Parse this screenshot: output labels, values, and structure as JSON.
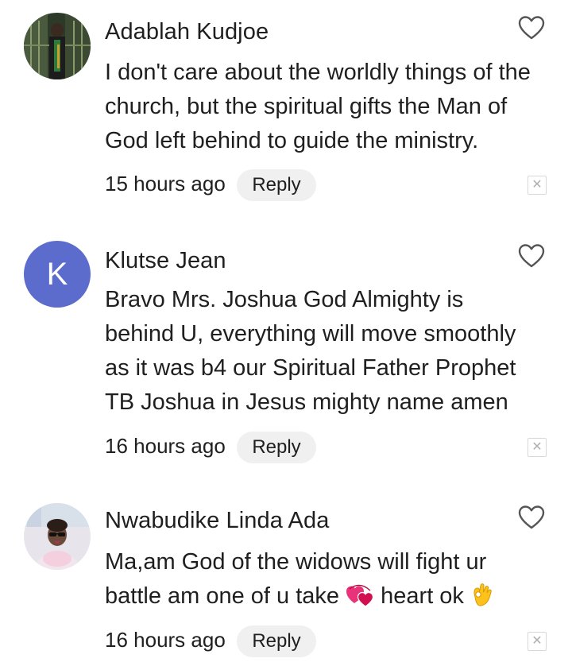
{
  "comments": [
    {
      "author": "Adablah Kudjoe",
      "text": "I don't care about the worldly things of the\nchurch, but the spiritual gifts the Man of\nGod left behind to guide the ministry.",
      "time": "15 hours ago",
      "reply_label": "Reply",
      "avatar_type": "photo"
    },
    {
      "author": "Klutse Jean",
      "avatar_letter": "K",
      "avatar_color": "#5b6ccc",
      "text": "Bravo Mrs. Joshua God Almighty is\nbehind U, everything will move smoothly\nas it was b4 our Spiritual Father Prophet\nTB Joshua in Jesus mighty name amen",
      "time": "16 hours ago",
      "reply_label": "Reply"
    },
    {
      "author": "Nwabudike Linda Ada",
      "text_line1": "Ma,am God of the widows  will fight ur",
      "text_line2_a": "battle am one of u take ",
      "text_line2_b": " heart ok ",
      "emoji_1": "revolving-hearts-icon",
      "emoji_2": "ok-hand-icon",
      "time": "16 hours ago",
      "reply_label": "Reply",
      "avatar_type": "photo"
    }
  ],
  "close_glyph": "✕",
  "colors": {
    "reply_bg": "#f0f0f0",
    "text": "#1f1f1f"
  }
}
